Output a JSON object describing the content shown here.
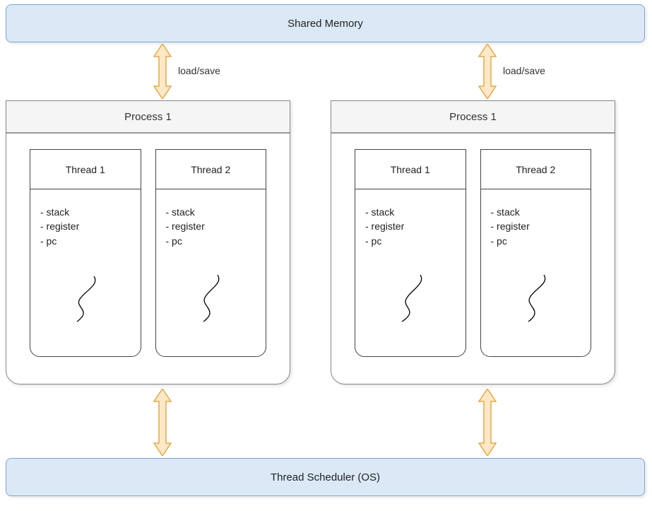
{
  "shared_memory": {
    "label": "Shared Memory"
  },
  "arrows": {
    "top_left_label": "load/save",
    "top_right_label": "load/save"
  },
  "process1": {
    "title": "Process 1",
    "thread1": {
      "title": "Thread 1",
      "line1": "- stack",
      "line2": "- register",
      "line3": "- pc"
    },
    "thread2": {
      "title": "Thread 2",
      "line1": "- stack",
      "line2": "- register",
      "line3": "- pc"
    }
  },
  "process2": {
    "title": "Process 1",
    "thread1": {
      "title": "Thread 1",
      "line1": "- stack",
      "line2": "- register",
      "line3": "- pc"
    },
    "thread2": {
      "title": "Thread 2",
      "line1": "- stack",
      "line2": "- register",
      "line3": "- pc"
    }
  },
  "scheduler": {
    "label": "Thread Scheduler (OS)"
  }
}
